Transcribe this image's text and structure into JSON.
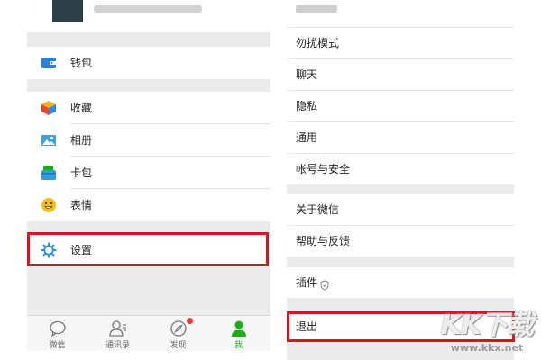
{
  "left_panel": {
    "menu": {
      "wallet": "钱包",
      "favorites": "收藏",
      "album": "相册",
      "cards": "卡包",
      "stickers": "表情",
      "settings": "设置"
    },
    "tabbar": {
      "chats": "微信",
      "contacts": "通讯录",
      "discover": "发现",
      "me": "我"
    }
  },
  "right_panel": {
    "items": {
      "do_not_disturb": "勿扰模式",
      "chat": "聊天",
      "privacy": "隐私",
      "general": "通用",
      "account_security": "帐号与安全",
      "about": "关于微信",
      "help_feedback": "帮助与反馈",
      "plugins": "插件",
      "logout": "退出"
    }
  },
  "watermarks": {
    "brand": "KK下载",
    "url": "www.kkx.net"
  },
  "colors": {
    "accent_green": "#1aad19",
    "highlight_red": "#d9141c",
    "badge_red": "#f43530",
    "background_gray": "#ebebeb"
  }
}
